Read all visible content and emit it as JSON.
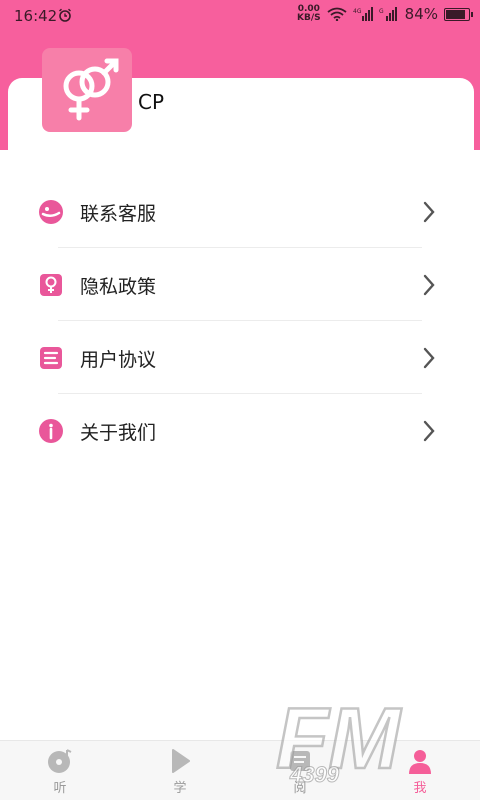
{
  "status_bar": {
    "time": "16:42",
    "net_speed_value": "0.00",
    "net_speed_unit": "KB/S",
    "battery": "84%"
  },
  "profile": {
    "name": "CP",
    "avatar_icon": "gender-symbol-icon"
  },
  "menu": [
    {
      "label": "联系客服",
      "icon": "customer-service-icon"
    },
    {
      "label": "隐私政策",
      "icon": "privacy-lock-icon"
    },
    {
      "label": "用户协议",
      "icon": "document-icon"
    },
    {
      "label": "关于我们",
      "icon": "info-icon"
    }
  ],
  "bottom_nav": [
    {
      "label": "听",
      "icon": "music-disc-icon",
      "active": false
    },
    {
      "label": "学",
      "icon": "play-icon",
      "active": false
    },
    {
      "label": "阅",
      "icon": "book-icon",
      "active": false
    },
    {
      "label": "我",
      "icon": "person-icon",
      "active": true
    }
  ],
  "watermark": {
    "big": "FM",
    "small": "4399"
  },
  "colors": {
    "accent": "#f75f9d",
    "icon": "#e9579a",
    "active_nav": "#f55f99"
  }
}
